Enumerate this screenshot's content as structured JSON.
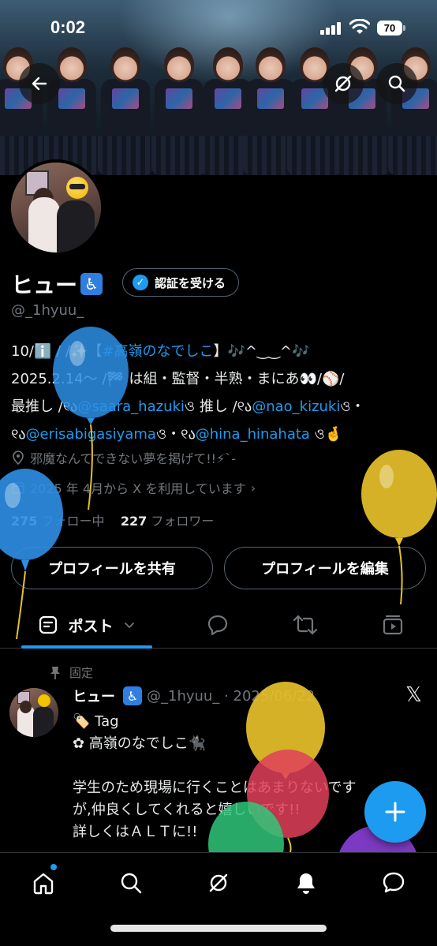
{
  "status_bar": {
    "time": "0:02",
    "battery": "70"
  },
  "profile": {
    "name": "ヒュー",
    "verify_label": "認証を受ける",
    "handle": "@_1hyuu_",
    "bio": {
      "line1_prefix": "10/ℹ️ / /✨【",
      "line1_tag": "#高嶺のなでしこ",
      "line1_suffix": "】🎶^‿‿^🎶",
      "line2": "2025.2.14～ /🏁 は組・監督・半熟・まにあ👀/⚾/",
      "line3_prefix": "最推し /୧ა",
      "line3_mention1": "@saara_hazuki",
      "line3_mid": "ও 推し /୧ა",
      "line3_mention2": "@nao_kizuki",
      "line3_suffix": "ও・",
      "line4_prefix": "୧ა",
      "line4_mention1": "@erisabigasiyama",
      "line4_mid": "ও・୧ა",
      "line4_mention2": "@hina_hinahata",
      "line4_suffix": " ও🤞"
    },
    "location": "邪魔なんてできない夢を掲げて!!⚡︎`-",
    "joined": "2025 年 4月から X を利用しています",
    "following_count": "275",
    "following_label": "フォロー中",
    "followers_count": "227",
    "followers_label": "フォロワー",
    "share_label": "プロフィールを共有",
    "edit_label": "プロフィールを編集"
  },
  "tabs": {
    "posts_label": "ポスト"
  },
  "pinned_post": {
    "pinned_label": "固定",
    "name": "ヒュー",
    "handle_date": "@_1hyuu_ · 2025/06/22",
    "body": "🏷️ Tag\n✿ 高嶺のなでしこ🐈‍⬛\n\n学生のため現場に行くことはあまりないです\nが,仲良くしてくれると嬉しいです!!\n詳しくはＡＬＴに!!"
  },
  "colors": {
    "accent": "#1d9bf0",
    "access_badge": "#2f7fe0",
    "balloon_blue": "#2d8fe6",
    "balloon_yellow": "#e6c02a",
    "balloon_red": "#e0405a",
    "balloon_green": "#2fc77a",
    "balloon_purple": "#8a3fd6"
  }
}
